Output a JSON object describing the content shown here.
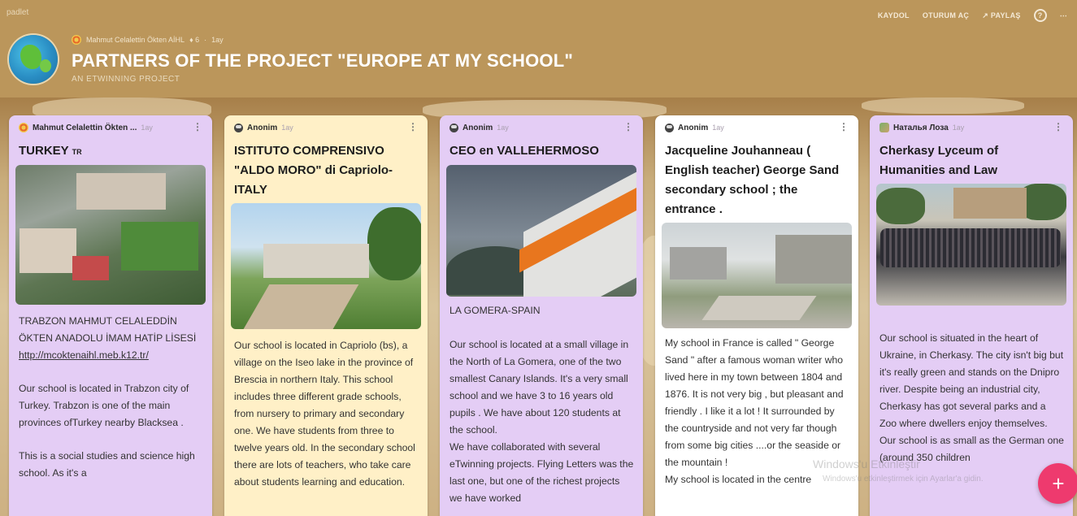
{
  "app": {
    "brand": "padlet"
  },
  "top_actions": {
    "signup": "KAYDOL",
    "login": "OTURUM AÇ",
    "share": "PAYLAŞ",
    "help": "?",
    "more": "⋯"
  },
  "header": {
    "author": "Mahmut Celalettin Ökten AİHL",
    "likes": "♦ 6",
    "time": "1ay",
    "title": "PARTNERS OF THE PROJECT \"EUROPE AT MY SCHOOL\"",
    "subtitle": "AN ETWINNING PROJECT"
  },
  "cards": [
    {
      "author": "Mahmut Celalettin Ökten ...",
      "time": "1ay",
      "title": "TURKEY",
      "title_suffix": "TR",
      "body": [
        "TRABZON MAHMUT CELALEDDİN ÖKTEN ANADOLU İMAM HATİP LİSESİ",
        "http://mcoktenaihl.meb.k12.tr/",
        "Our school is located in Trabzon city of Turkey. Trabzon is one of the main provinces ofTurkey nearby Blacksea .",
        "This is a social studies and science high school. As it's a"
      ]
    },
    {
      "author": "Anonim",
      "time": "1ay",
      "title": "ISTITUTO COMPRENSIVO \"ALDO MORO\" di Capriolo- ITALY",
      "body": [
        "Our school is located in Capriolo (bs), a village on the Iseo lake in the province of Brescia in northern Italy. This school includes three different grade schools, from nursery to primary and secondary one. We have students from three to twelve years old. In the secondary school there are lots of teachers, who take care about students learning and education."
      ]
    },
    {
      "author": "Anonim",
      "time": "1ay",
      "title": "CEO en VALLEHERMOSO",
      "caption": "LA GOMERA-SPAIN",
      "body": [
        "Our school is located at a small village in the North of La Gomera, one of the two smallest Canary Islands. It's a very small school and we have 3 to 16 years old pupils . We have about 120 students at the school.",
        "We have collaborated with several eTwinning projects. Flying Letters was the last one, but one of the richest projects we have worked"
      ]
    },
    {
      "author": "Anonim",
      "time": "1ay",
      "title": "Jacqueline Jouhanneau ( English teacher) George Sand secondary school ; the entrance .",
      "body": [
        "My school in France is called \" George Sand \" after a famous woman writer who lived here in my town between 1804 and 1876. It is not very big , but pleasant and friendly . I like it a lot ! It surrounded by the countryside and not very far though from some big cities ....or the seaside or the mountain !",
        "My school is located in the centre"
      ]
    },
    {
      "author": "Наталья Лоза",
      "time": "1ay",
      "title": "Cherkasy Lyceum of Humanities and Law",
      "body": [
        "Our school is situated in the heart of Ukraine, in Cherkasy. The city isn't big but it's really green and stands on the Dnipro river. Despite being an industrial city, Cherkasy has got several parks and a Zoo where dwellers enjoy themselves.",
        "Our school is as small as the German one (around 350 children"
      ]
    }
  ],
  "watermark": {
    "line1": "Windows'u Etkinleştir",
    "line2": "Windows'u etkinleştirmek için Ayarlar'a gidin."
  },
  "fab": {
    "label": "+"
  },
  "colors": {
    "header_bg": "#bb965b",
    "card_purple": "#e4cdf5",
    "card_yellow": "#fff0c7",
    "card_white": "#ffffff",
    "fab": "#ee3a6e"
  }
}
